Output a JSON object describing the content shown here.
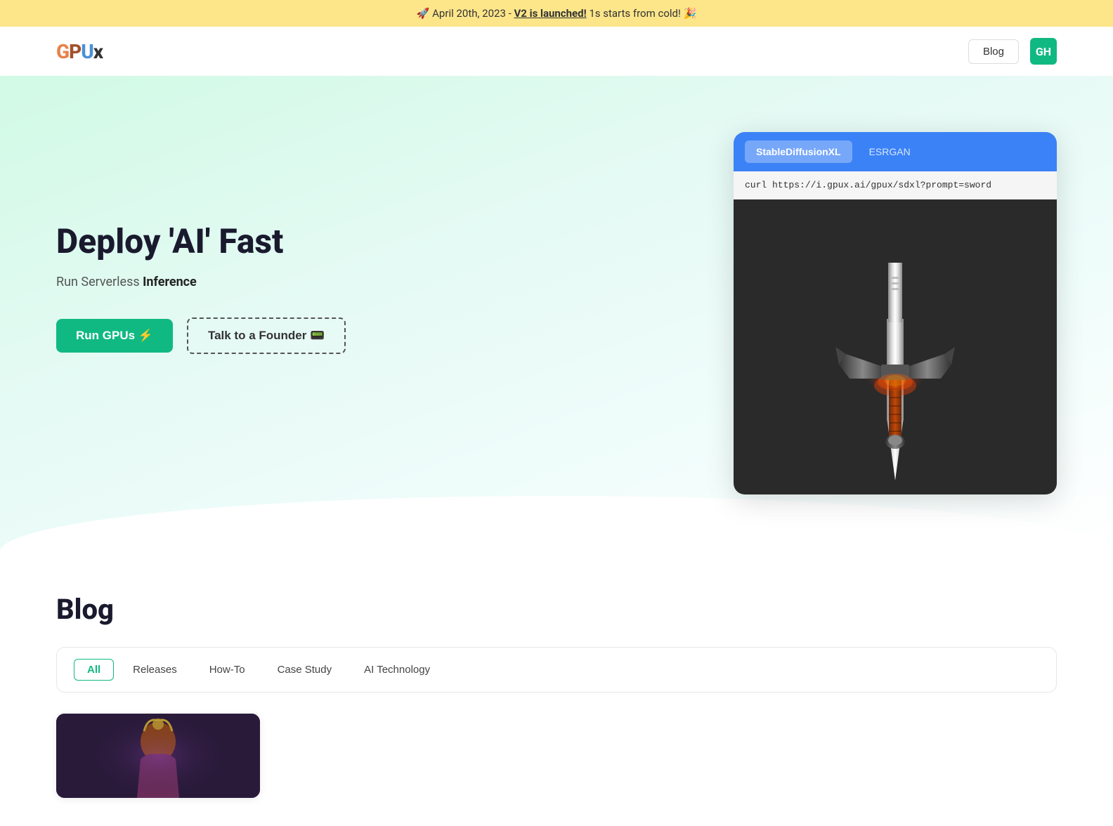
{
  "announcement": {
    "text_before": "🚀 April 20th, 2023 - ",
    "link_text": "V2 is launched!",
    "text_after": " 1s starts from cold! 🎉"
  },
  "navbar": {
    "logo": "GPUx",
    "blog_button": "Blog",
    "avatar_initials": "GH"
  },
  "hero": {
    "title": "Deploy 'AI' Fast",
    "subtitle_prefix": "Run Serverless ",
    "subtitle_bold": "Inference",
    "run_gpus_btn": "Run GPUs ⚡",
    "talk_founder_btn": "Talk to a Founder 📟"
  },
  "demo_card": {
    "tab1": "StableDiffusionXL",
    "tab2": "ESRGAN",
    "curl_command": "curl https://i.gpux.ai/gpux/sdxl?prompt=sword",
    "image_alt": "AI generated sword image"
  },
  "blog": {
    "title": "Blog",
    "filters": [
      {
        "label": "All",
        "active": true
      },
      {
        "label": "Releases",
        "active": false
      },
      {
        "label": "How-To",
        "active": false
      },
      {
        "label": "Case Study",
        "active": false
      },
      {
        "label": "AI Technology",
        "active": false
      }
    ]
  }
}
